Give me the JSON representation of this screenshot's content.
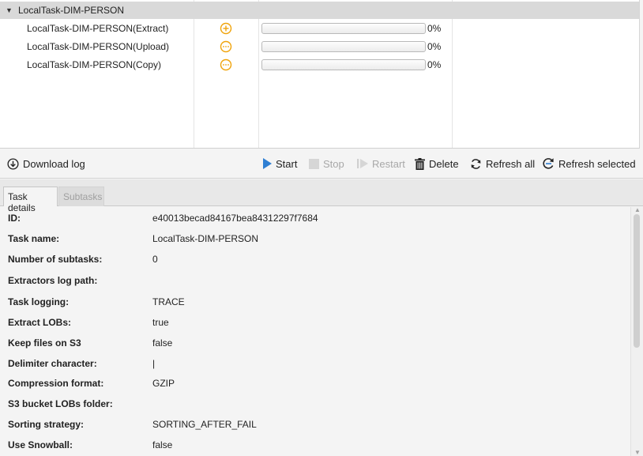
{
  "tree": {
    "group_label": "LocalTask-DIM-PERSON",
    "rows": [
      {
        "name": "LocalTask-DIM-PERSON(Extract)",
        "status_icon": "plus-circle-icon",
        "progress": 0,
        "percent": "0%"
      },
      {
        "name": "LocalTask-DIM-PERSON(Upload)",
        "status_icon": "dots-circle-icon",
        "progress": 0,
        "percent": "0%"
      },
      {
        "name": "LocalTask-DIM-PERSON(Copy)",
        "status_icon": "dots-circle-icon",
        "progress": 0,
        "percent": "0%"
      }
    ]
  },
  "toolbar": {
    "download_log": "Download log",
    "start": "Start",
    "stop": "Stop",
    "restart": "Restart",
    "delete": "Delete",
    "refresh_all": "Refresh all",
    "refresh_selected": "Refresh selected"
  },
  "tabs": {
    "task_details": "Task details",
    "subtasks": "Subtasks"
  },
  "details": [
    {
      "key": "ID:",
      "value": "e40013becad84167bea84312297f7684"
    },
    {
      "key": "Task name:",
      "value": "LocalTask-DIM-PERSON"
    },
    {
      "key": "Number of subtasks:",
      "value": "0"
    },
    {
      "key": "Extractors log path:",
      "value": ""
    },
    {
      "key": "Task logging:",
      "value": "TRACE"
    },
    {
      "key": "Extract LOBs:",
      "value": "true"
    },
    {
      "key": "Keep files on S3",
      "value": "false"
    },
    {
      "key": "Delimiter character:",
      "value": "|"
    },
    {
      "key": "Compression format:",
      "value": "GZIP"
    },
    {
      "key": "S3 bucket LOBs folder:",
      "value": ""
    },
    {
      "key": "Sorting strategy:",
      "value": "SORTING_AFTER_FAIL"
    },
    {
      "key": "Use Snowball:",
      "value": "false"
    }
  ],
  "colors": {
    "accent_orange": "#f0a30a",
    "play_blue": "#2f7fd3",
    "disabled": "#a8a8a8",
    "header_gray": "#d9d9d9"
  }
}
